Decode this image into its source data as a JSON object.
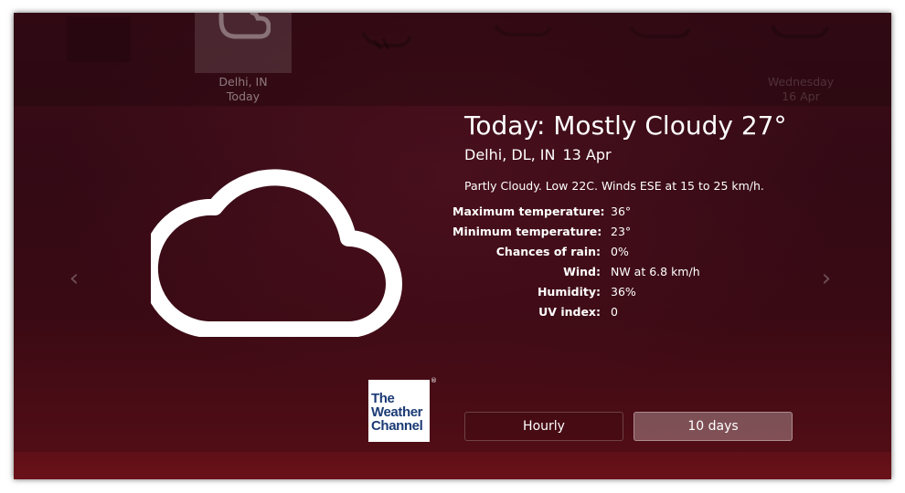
{
  "carousel": {
    "cards": [
      {
        "location": "",
        "day": "",
        "icon": "sun-icon",
        "active": false
      },
      {
        "location": "Delhi, IN",
        "day": "Today",
        "icon": "cloud-icon",
        "active": true
      },
      {
        "location": "",
        "day": "",
        "icon": "thunderstorm-icon",
        "active": false
      },
      {
        "location": "",
        "day": "",
        "icon": "cloud-icon",
        "active": false
      },
      {
        "location": "",
        "day": "",
        "icon": "cloud-icon",
        "active": false
      },
      {
        "location": "",
        "day": "",
        "icon": "cloud-icon",
        "active": false
      },
      {
        "location": "Wednesday",
        "day": "16 Apr",
        "icon": "cloud-icon",
        "active": false
      }
    ]
  },
  "current": {
    "title": "Today: Mostly Cloudy 27°",
    "location": "Delhi, DL, IN",
    "date": "13 Apr",
    "summary": "Partly Cloudy. Low 22C. Winds ESE at 15 to 25 km/h.",
    "icon": "cloud-icon"
  },
  "details": [
    {
      "label": "Maximum temperature:",
      "value": "36°"
    },
    {
      "label": "Minimum temperature:",
      "value": "23°"
    },
    {
      "label": "Chances of rain:",
      "value": "0%"
    },
    {
      "label": "Wind:",
      "value": "NW at 6.8 km/h"
    },
    {
      "label": "Humidity:",
      "value": "36%"
    },
    {
      "label": "UV index:",
      "value": "0"
    }
  ],
  "nav": {
    "prev": "‹",
    "next": "›"
  },
  "logo": {
    "line1": "The",
    "line2": "Weather",
    "line3": "Channel",
    "mark": "®"
  },
  "buttons": {
    "hourly": "Hourly",
    "ten_days": "10 days"
  }
}
